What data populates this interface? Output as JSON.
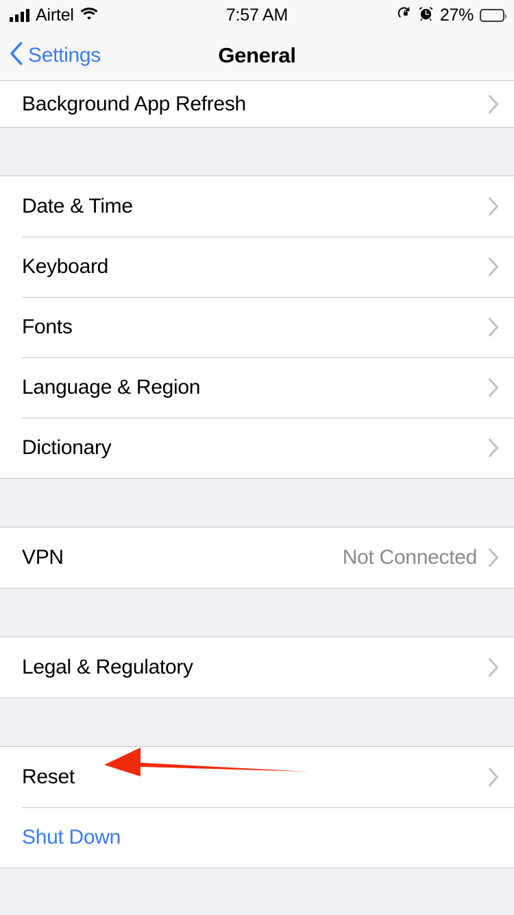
{
  "status_bar": {
    "carrier": "Airtel",
    "signal_icon": "cellular-signal-icon",
    "wifi_icon": "wifi-icon",
    "time": "7:57 AM",
    "rotation_lock_icon": "rotation-lock-icon",
    "alarm_icon": "alarm-clock-icon",
    "battery_percent": "27%",
    "battery_level": 27
  },
  "nav_bar": {
    "back_label": "Settings",
    "back_icon": "chevron-left-icon",
    "title": "General"
  },
  "colors": {
    "accent_blue": "#3b7cf6",
    "group_background": "#ffffff",
    "page_background": "#f1f1f5",
    "separator": "#c8c7cc",
    "value_gray": "#8a8a8e",
    "chevron_gray": "#c0c0c4",
    "annotation_red": "#ef2b0c"
  },
  "groups": [
    {
      "id": "group-partial",
      "rows": [
        {
          "label": "Background App Refresh",
          "value": "",
          "accessory": "chevron-right-icon",
          "style": "default",
          "partial": true
        }
      ]
    },
    {
      "id": "group-localization",
      "rows": [
        {
          "label": "Date & Time",
          "value": "",
          "accessory": "chevron-right-icon",
          "style": "default",
          "partial": false
        },
        {
          "label": "Keyboard",
          "value": "",
          "accessory": "chevron-right-icon",
          "style": "default",
          "partial": false
        },
        {
          "label": "Fonts",
          "value": "",
          "accessory": "chevron-right-icon",
          "style": "default",
          "partial": false
        },
        {
          "label": "Language & Region",
          "value": "",
          "accessory": "chevron-right-icon",
          "style": "default",
          "partial": false
        },
        {
          "label": "Dictionary",
          "value": "",
          "accessory": "chevron-right-icon",
          "style": "default",
          "partial": false
        }
      ]
    },
    {
      "id": "group-vpn",
      "rows": [
        {
          "label": "VPN",
          "value": "Not Connected",
          "accessory": "chevron-right-icon",
          "style": "default",
          "partial": false
        }
      ]
    },
    {
      "id": "group-legal",
      "rows": [
        {
          "label": "Legal & Regulatory",
          "value": "",
          "accessory": "chevron-right-icon",
          "style": "default",
          "partial": false
        }
      ]
    },
    {
      "id": "group-reset",
      "rows": [
        {
          "label": "Reset",
          "value": "",
          "accessory": "chevron-right-icon",
          "style": "default",
          "partial": false
        },
        {
          "label": "Shut Down",
          "value": "",
          "accessory": "",
          "style": "accent",
          "partial": false
        }
      ]
    }
  ],
  "annotation": {
    "type": "arrow",
    "points_to": "Reset",
    "direction": "left",
    "color": "#ef2b0c"
  }
}
